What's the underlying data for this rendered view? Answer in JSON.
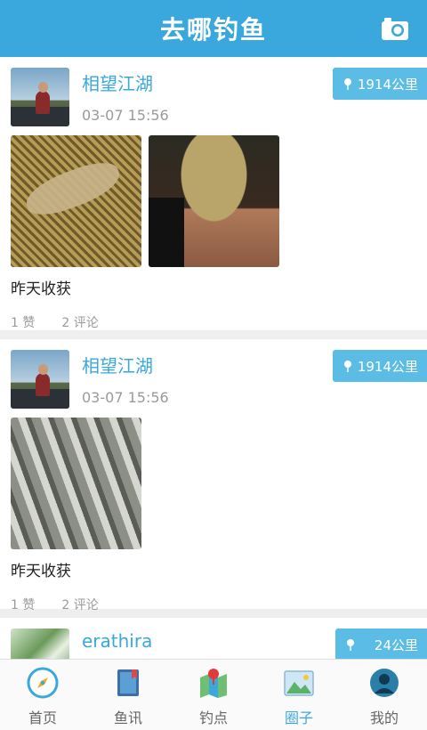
{
  "header": {
    "title": "去哪钓鱼"
  },
  "posts": [
    {
      "user": "相望江湖",
      "time": "03-07 15:56",
      "distance": "1914公里",
      "caption": "昨天收获",
      "likes": "1 赞",
      "comments": "2 评论"
    },
    {
      "user": "相望江湖",
      "time": "03-07 15:56",
      "distance": "1914公里",
      "caption": "昨天收获",
      "likes": "1 赞",
      "comments": "2 评论"
    },
    {
      "user": "erathira",
      "distance": "24公里"
    }
  ],
  "tabs": [
    {
      "label": "首页",
      "icon": "compass-icon"
    },
    {
      "label": "鱼讯",
      "icon": "book-icon"
    },
    {
      "label": "钓点",
      "icon": "map-pin-icon"
    },
    {
      "label": "圈子",
      "icon": "photo-icon",
      "active": true
    },
    {
      "label": "我的",
      "icon": "user-icon"
    }
  ],
  "colors": {
    "accent": "#3aa8dc",
    "badge": "#5bbce6"
  }
}
